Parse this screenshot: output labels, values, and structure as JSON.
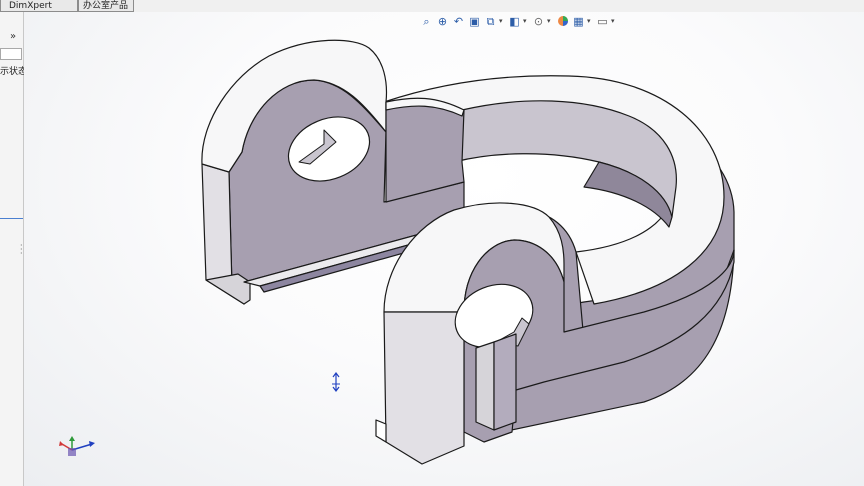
{
  "tabs": {
    "dimxpert": "DimXpert",
    "office_products": "办公室产品"
  },
  "left_panel": {
    "expand_glyph": "»",
    "display_state_label": "示状态"
  },
  "toolbar": {
    "icons": [
      "zoom-to-fit-icon",
      "zoom-to-area-icon",
      "previous-view-icon",
      "section-view-icon",
      "view-orientation-icon",
      "display-style-icon",
      "hide-show-items-icon",
      "edit-appearance-icon",
      "apply-scene-icon",
      "view-settings-icon"
    ]
  },
  "colors": {
    "face_side": "#a79fb0",
    "face_top": "#f7f7f8",
    "face_front": "#d6d4d9",
    "edge": "#1a1a1a",
    "triad_x": "#d23a3a",
    "triad_y": "#2e9a3a",
    "triad_z": "#2040c0"
  }
}
